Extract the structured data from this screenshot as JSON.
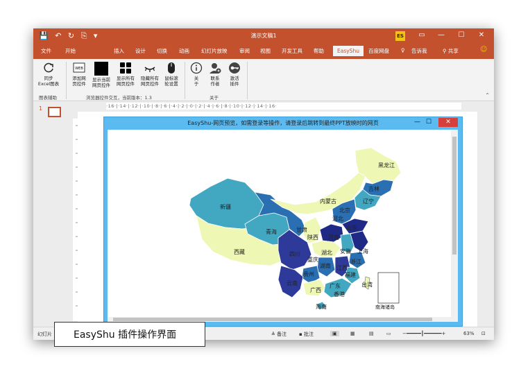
{
  "window": {
    "title": "演示文稿1",
    "quick_access": "💾 ↶ ↻ ⎘ ▾",
    "badge": "ES",
    "share_label": "共享",
    "tell_me": "告诉我"
  },
  "tabs": [
    {
      "label": "文件"
    },
    {
      "label": "开始"
    },
    {
      "label": "插入"
    },
    {
      "label": "设计"
    },
    {
      "label": "切换"
    },
    {
      "label": "动画"
    },
    {
      "label": "幻灯片放映"
    },
    {
      "label": "审阅"
    },
    {
      "label": "视图"
    },
    {
      "label": "开发工具"
    },
    {
      "label": "帮助"
    },
    {
      "label": "EasyShu"
    },
    {
      "label": "百度网盘"
    }
  ],
  "ribbon": {
    "group1": {
      "btn1": [
        "同步",
        "Excel图表"
      ],
      "label": "图表辅助"
    },
    "group2": {
      "buttons": [
        [
          "添加网",
          "页控件"
        ],
        [
          "显示当前",
          "网页控件"
        ],
        [
          "显示所有",
          "网页控件"
        ],
        [
          "隐藏所有",
          "网页控件"
        ],
        [
          "鼠标滚",
          "轮设置"
        ]
      ],
      "label": "浏览器控件交互，当前版本：1.3"
    },
    "group3": {
      "buttons": [
        [
          "关",
          "于"
        ],
        [
          "联系",
          "作者"
        ],
        [
          "激活",
          "插件"
        ]
      ],
      "label": "关于"
    }
  },
  "slide_panel": {
    "number": "1"
  },
  "ruler": {
    "marks": "·16·|·14·|·12·|·10·|·8·|·6·|·4·|·2·|·0·|·2·|·4·|·6·|·8·|·10·|·12·|·14·|·16·"
  },
  "popup": {
    "title": "EasyShu-网页预览，如需登录等操作，请登录后跳转到最终PPT放映时的网页",
    "close": "✕"
  },
  "map_labels": {
    "heilongjiang": "黑龙江",
    "jilin": "吉林",
    "liaoning": "辽宁",
    "neimenggu": "内蒙古",
    "xinjiang": "新疆",
    "beijing": "北京",
    "hebei": "河北",
    "gansu": "甘肃",
    "qinghai": "青海",
    "shandong": "山东",
    "shaanxi": "陕西",
    "henan": "河南",
    "xizang": "西藏",
    "sichuan": "四川",
    "hubei": "湖北",
    "anhui": "安徽",
    "shanghai": "上海",
    "chongqing": "重庆",
    "zhejiang": "浙江",
    "hunan": "湖南",
    "jiangxi": "江西",
    "guizhou": "贵州",
    "fujian": "福建",
    "yunnan": "云南",
    "guangxi": "广西",
    "guangdong": "广东",
    "taiwan": "台湾",
    "hongkong": "香港",
    "hainan": "海南",
    "nanhai": "南海诸岛"
  },
  "statusbar": {
    "slide": "幻灯片",
    "notes": "备注",
    "comments": "批注",
    "zoom": "63%"
  },
  "caption": "EasyShu 插件操作界面",
  "colors": {
    "accent": "#c4512d",
    "popup_border": "#5bbaf0",
    "map_dark": "#1f2a87",
    "map_mid": "#2b6fb3",
    "map_teal": "#42a7c1",
    "map_light": "#eef7b4"
  }
}
